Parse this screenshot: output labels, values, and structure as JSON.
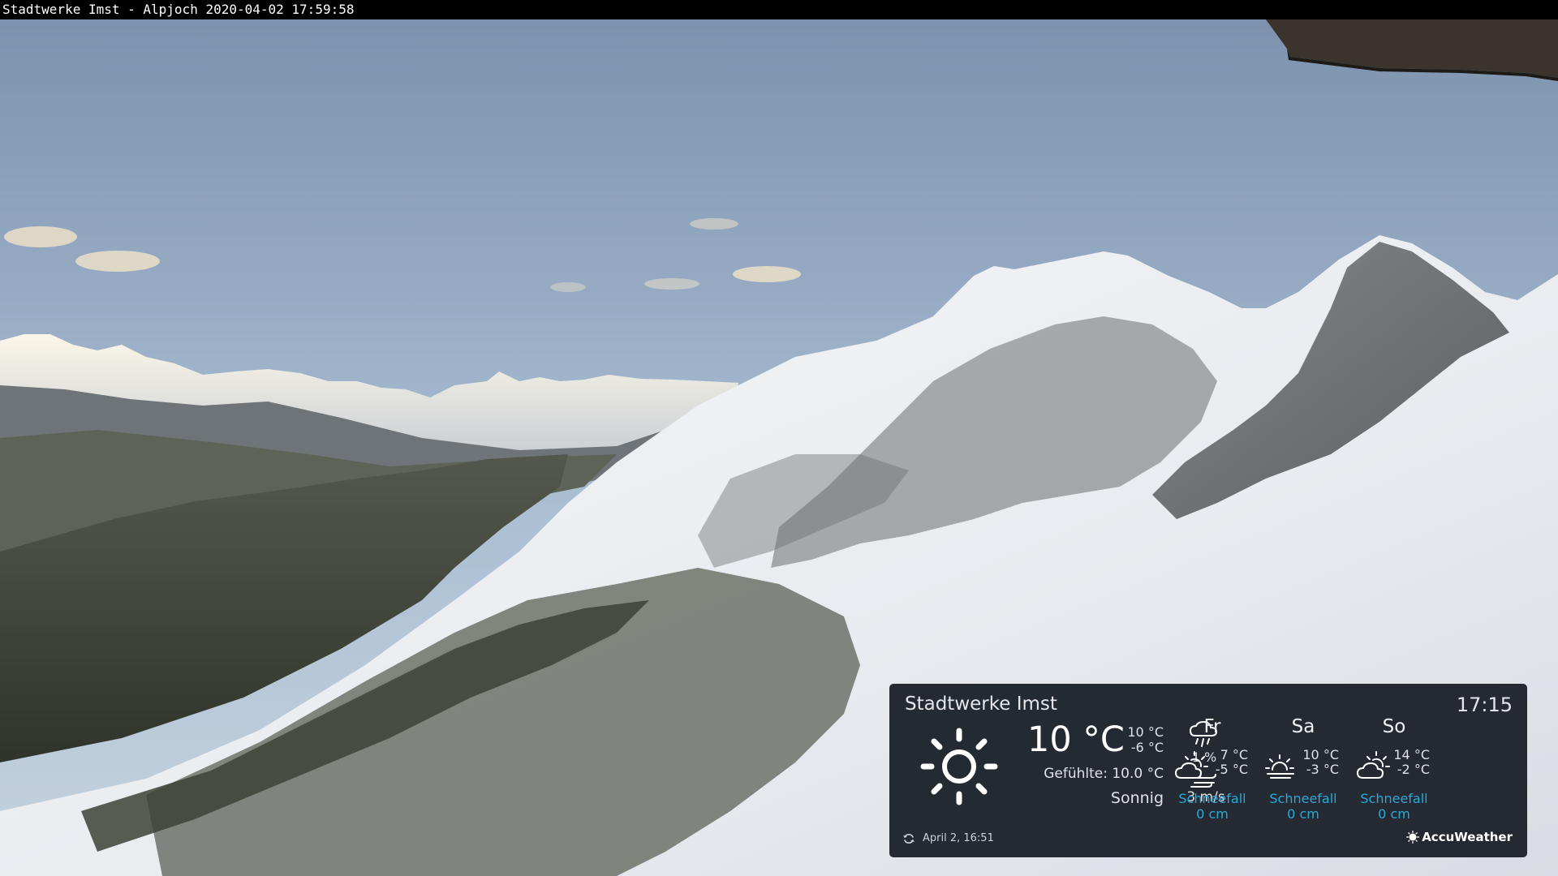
{
  "camera": {
    "title": "Stadtwerke Imst - Alpjoch 2020-04-02 17:59:58"
  },
  "weather": {
    "location": "Stadtwerke Imst",
    "time": "17:15",
    "current": {
      "icon": "sun-icon",
      "temperature": "10 °C",
      "high": "10 °C",
      "low": "-6 °C",
      "feels_like": "Gefühlte: 10.0 °C",
      "condition": "Sonnig",
      "precip_icon": "rain-cloud-icon",
      "precip_chance": "1 %",
      "wind_icon": "wind-icon",
      "wind_speed": "3 m/s"
    },
    "forecast": [
      {
        "day": "Fr",
        "icon": "partly-cloudy-icon",
        "high": "7 °C",
        "low": "-5 °C",
        "label": "Schneefall",
        "amount": "0 cm"
      },
      {
        "day": "Sa",
        "icon": "sun-haze-icon",
        "high": "10 °C",
        "low": "-3 °C",
        "label": "Schneefall",
        "amount": "0 cm"
      },
      {
        "day": "So",
        "icon": "partly-cloudy-icon",
        "high": "14 °C",
        "low": "-2 °C",
        "label": "Schneefall",
        "amount": "0 cm"
      }
    ],
    "updated": "April 2, 16:51",
    "brand": "AccuWeather"
  },
  "colors": {
    "sky_top": "#7d93ae",
    "sky_bottom": "#b7c8da",
    "snow": "#eef0f3",
    "rock": "#5c5e61",
    "forest": "#3c4236",
    "panel": "#161b24",
    "accent": "#29a9d8"
  }
}
